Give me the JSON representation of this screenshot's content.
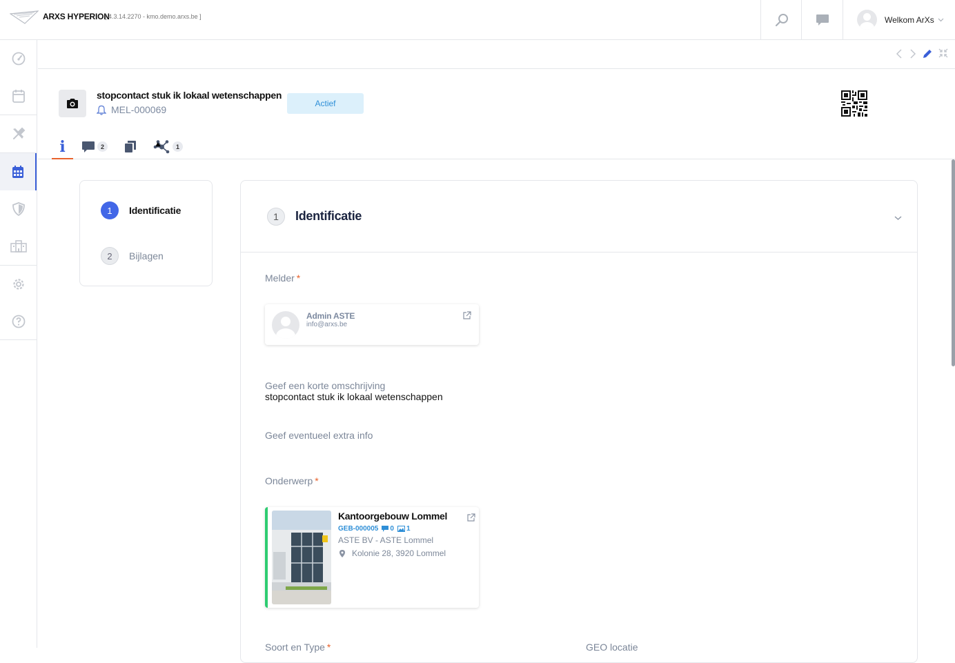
{
  "app": {
    "name": "ARXS HYPERION",
    "version": "[ 4.3.14.2270 - kmo.demo.arxs.be ]"
  },
  "topbar": {
    "search_icon": "search-icon",
    "chat_icon": "chat-icon",
    "welcome": "Welkom ArXs"
  },
  "sidebar": {
    "items": [
      {
        "icon": "dashboard-icon"
      },
      {
        "icon": "calendar-icon"
      },
      {
        "icon": "tools-icon"
      },
      {
        "icon": "planning-icon",
        "active": true
      },
      {
        "icon": "shield-icon"
      },
      {
        "icon": "building-icon"
      },
      {
        "icon": "settings-icon"
      },
      {
        "icon": "help-icon"
      }
    ]
  },
  "record": {
    "title": "stopcontact stuk ik lokaal wetenschappen",
    "code": "MEL-000069",
    "status": "Actief"
  },
  "tabs": [
    {
      "label": "i",
      "active": true
    },
    {
      "icon": "comments-icon",
      "badge": "2"
    },
    {
      "icon": "copy-icon"
    },
    {
      "icon": "relations-icon",
      "badge": "1"
    }
  ],
  "steps": [
    {
      "num": "1",
      "label": "Identificatie",
      "active": true
    },
    {
      "num": "2",
      "label": "Bijlagen",
      "active": false
    }
  ],
  "section": {
    "num": "1",
    "title": "Identificatie"
  },
  "fields": {
    "melder_label": "Melder",
    "melder": {
      "name": "Admin ASTE",
      "email": "info@arxs.be"
    },
    "description_label": "Geef een korte omschrijving",
    "description_value": "stopcontact stuk ik lokaal wetenschappen",
    "extra_label": "Geef eventueel extra info",
    "subject_label": "Onderwerp",
    "building": {
      "name": "Kantoorgebouw Lommel",
      "code": "GEB-000005",
      "comments": "0",
      "images": "1",
      "company": "ASTE BV - ASTE Lommel",
      "address": "Kolonie 28, 3920 Lommel"
    },
    "type_label": "Soort en Type",
    "geo_label": "GEO locatie"
  },
  "colors": {
    "accent": "#4267e7",
    "tab_underline": "#e8622c",
    "status_bg": "#dcf0fb",
    "status_text": "#2f8fd7",
    "building_bar": "#2ecc71"
  }
}
